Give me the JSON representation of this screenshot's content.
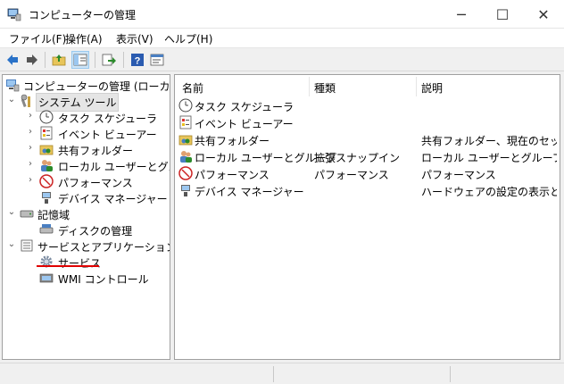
{
  "window": {
    "title": "コンピューターの管理",
    "minimize": "─",
    "maximize": "☐",
    "close": "✕"
  },
  "menu": [
    "ファイル(F)",
    "操作(A)",
    "表示(V)",
    "ヘルプ(H)"
  ],
  "toolbar": {
    "icons": [
      "back-icon",
      "forward-icon",
      "up-folder-icon",
      "show-hide-tree-icon",
      "export-list-icon",
      "help-icon",
      "properties-icon"
    ]
  },
  "tree": {
    "root": "コンピューターの管理 (ローカル)",
    "system_tools": "システム ツール",
    "task_scheduler": "タスク スケジューラ",
    "event_viewer": "イベント ビューアー",
    "shared_folders": "共有フォルダー",
    "local_users": "ローカル ユーザーとグループ",
    "performance": "パフォーマンス",
    "device_manager": "デバイス マネージャー",
    "storage": "記憶域",
    "disk_management": "ディスクの管理",
    "services_apps": "サービスとアプリケーション",
    "services": "サービス",
    "wmi": "WMI コントロール",
    "expand_open": "⌄",
    "expand_closed": "›"
  },
  "list": {
    "headers": [
      "名前",
      "種類",
      "説明"
    ],
    "rows": [
      {
        "name": "タスク スケジューラ",
        "type": "",
        "desc": ""
      },
      {
        "name": "イベント ビューアー",
        "type": "",
        "desc": ""
      },
      {
        "name": "共有フォルダー",
        "type": "",
        "desc": "共有フォルダー、現在のセッ..."
      },
      {
        "name": "ローカル ユーザーとグループ",
        "type": "拡張スナップイン",
        "desc": "ローカル ユーザーとグループを..."
      },
      {
        "name": "パフォーマンス",
        "type": "パフォーマンス",
        "desc": "パフォーマンス"
      },
      {
        "name": "デバイス マネージャー",
        "type": "",
        "desc": "ハードウェアの設定の表示と..."
      }
    ]
  },
  "colors": {
    "accent": "#2a72c8",
    "selection": "#e5e5e5",
    "annotation": "#e00000"
  }
}
